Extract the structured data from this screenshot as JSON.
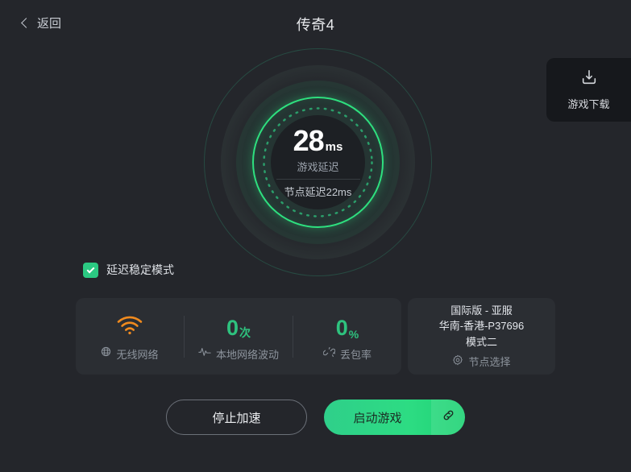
{
  "header": {
    "back_label": "返回",
    "title": "传奇4",
    "back_icon": "chevron-left-icon"
  },
  "download_tab": {
    "label": "游戏下载",
    "icon": "download-icon"
  },
  "gauge": {
    "latency_value": "28",
    "latency_unit": "ms",
    "latency_label": "游戏延迟",
    "node_latency": "节点延迟22ms",
    "accent_color": "#2ee07f"
  },
  "stable_mode": {
    "label": "延迟稳定模式",
    "checked": true,
    "checkbox_color": "#2bc982"
  },
  "stats": [
    {
      "value": "",
      "suffix": "",
      "name": "无线网络",
      "top_icon": "wifi-icon",
      "name_icon": "globe-icon",
      "top_icon_color": "#f08a1e"
    },
    {
      "value": "0",
      "suffix": "次",
      "name": "本地网络波动",
      "top_icon": "",
      "name_icon": "pulse-icon",
      "top_icon_color": "#2ec27e"
    },
    {
      "value": "0",
      "suffix": "%",
      "name": "丢包率",
      "top_icon": "",
      "name_icon": "broken-link-icon",
      "top_icon_color": "#2ec27e"
    }
  ],
  "node": {
    "line1": "国际版 - 亚服",
    "line2": "华南-香港-P37696",
    "line3": "模式二",
    "picker_label": "节点选择",
    "picker_icon": "gear-icon"
  },
  "actions": {
    "stop_label": "停止加速",
    "start_label": "启动游戏",
    "link_icon": "link-icon"
  }
}
